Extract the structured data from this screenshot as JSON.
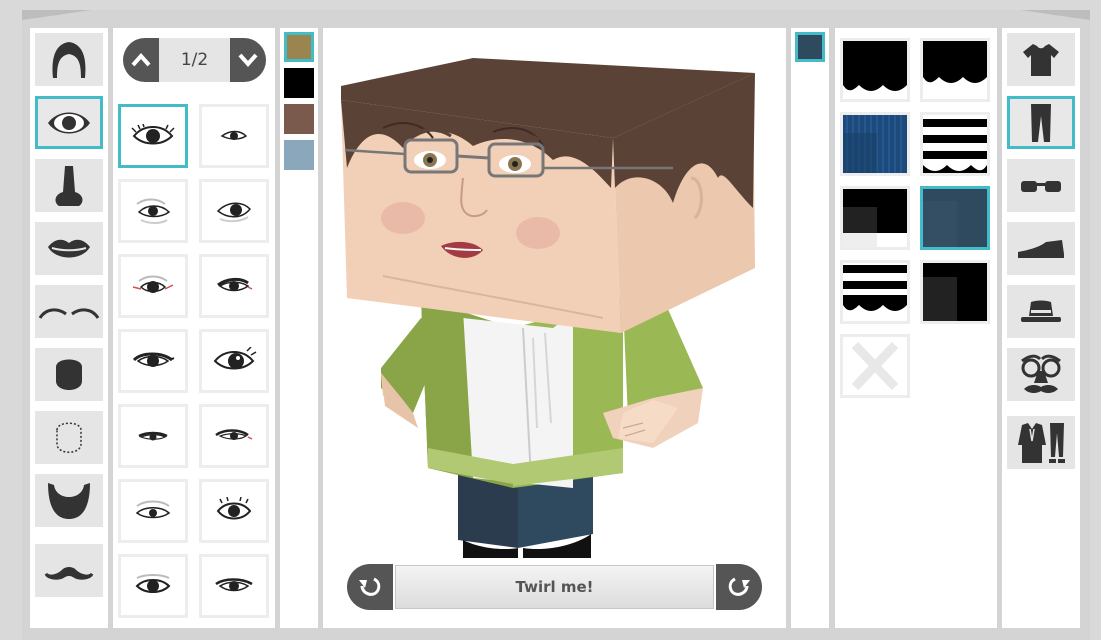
{
  "pager": {
    "text": "1/2"
  },
  "twirl": {
    "label": "Twirl me!"
  },
  "left_categories": [
    {
      "name": "hair",
      "icon": "hair-icon",
      "selected": false
    },
    {
      "name": "eyes",
      "icon": "eye-icon",
      "selected": true
    },
    {
      "name": "nose",
      "icon": "nose-icon",
      "selected": false
    },
    {
      "name": "mouth",
      "icon": "lips-icon",
      "selected": false
    },
    {
      "name": "eyebrows",
      "icon": "eyebrows-icon",
      "selected": false
    },
    {
      "name": "face-shape",
      "icon": "face-shape-icon",
      "selected": false
    },
    {
      "name": "face-outline",
      "icon": "face-outline-icon",
      "selected": false
    },
    {
      "name": "beard",
      "icon": "beard-icon",
      "selected": false
    },
    {
      "name": "mustache",
      "icon": "mustache-icon",
      "selected": false
    }
  ],
  "right_categories": [
    {
      "name": "shirt",
      "icon": "tshirt-icon",
      "selected": false
    },
    {
      "name": "pants",
      "icon": "pants-icon",
      "selected": true
    },
    {
      "name": "glasses",
      "icon": "glasses-icon",
      "selected": false
    },
    {
      "name": "shoes",
      "icon": "shoe-icon",
      "selected": false
    },
    {
      "name": "hat",
      "icon": "hat-icon",
      "selected": false
    },
    {
      "name": "disguise",
      "icon": "disguise-icon",
      "selected": false
    },
    {
      "name": "outfit",
      "icon": "outfit-icon",
      "selected": false
    }
  ],
  "eye_colors": [
    "#9a8550",
    "#000000",
    "#7b5a4e",
    "#8ba7bb"
  ],
  "eye_color_selected": 0,
  "pants_colors": [
    "#2f4a5e"
  ],
  "colors": {
    "accent": "#43bcc7",
    "button": "#555555"
  },
  "eye_options_selected": 0,
  "pattern_selected": 5
}
